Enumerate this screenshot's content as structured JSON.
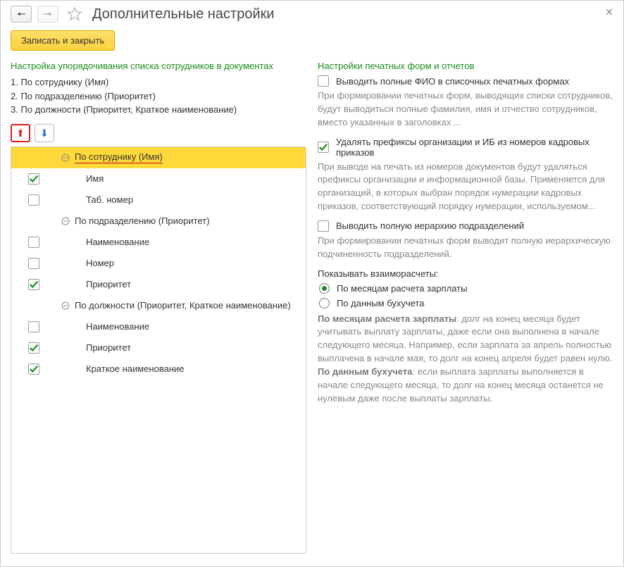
{
  "window": {
    "title": "Дополнительные настройки"
  },
  "toolbar": {
    "save_close": "Записать и закрыть"
  },
  "left": {
    "section_title": "Настройка упорядочивания списка сотрудников в документах",
    "ordering": [
      "1. По сотруднику (Имя)",
      "2. По подразделению (Приоритет)",
      "3. По должности (Приоритет, Краткое наименование)"
    ],
    "tree": {
      "groups": [
        {
          "label": "По сотруднику (Имя)",
          "selected": true,
          "items": [
            {
              "label": "Имя",
              "checked": true
            },
            {
              "label": "Таб. номер",
              "checked": false
            }
          ]
        },
        {
          "label": "По подразделению (Приоритет)",
          "selected": false,
          "items": [
            {
              "label": "Наименование",
              "checked": false
            },
            {
              "label": "Номер",
              "checked": false
            },
            {
              "label": "Приоритет",
              "checked": true
            }
          ]
        },
        {
          "label": "По должности (Приоритет, Краткое наименование)",
          "selected": false,
          "items": [
            {
              "label": "Наименование",
              "checked": false
            },
            {
              "label": "Приоритет",
              "checked": true
            },
            {
              "label": "Краткое наименование",
              "checked": true
            }
          ]
        }
      ]
    }
  },
  "right": {
    "section_title": "Настройки печатных форм и отчетов",
    "opt_full_fio": {
      "label": "Выводить полные ФИО в списочных печатных формах",
      "checked": false,
      "desc": "При формировании печатных форм, выводящих списки сотрудников, будут выводиться полные фамилия, имя и отчество сотрудников, вместо указанных в заголовках ..."
    },
    "opt_delete_prefix": {
      "label": "Удалять префиксы организации и ИБ из номеров кадровых приказов",
      "checked": true,
      "desc": "При выводе на печать из номеров документов будут удаляться префиксы организации и информационной базы. Применяется для организаций, в которых выбран порядок нумерации кадровых приказов, соответствующий порядку нумерации, используемом..."
    },
    "opt_hierarchy": {
      "label": "Выводить полную иерархию подразделений",
      "checked": false,
      "desc": "При формировании печатных форм выводит полную иерархическую подчиненность подразделений."
    },
    "mutual": {
      "title": "Показывать взаиморасчеты:",
      "radio1": "По месяцам расчета зарплаты",
      "radio2": "По данным бухучета",
      "selected": 0,
      "info_bold1": "По месяцам расчета зарплаты",
      "info_text1": ": долг на конец месяца будет учитывать выплату зарплаты, даже если она выполнена в начале следующего месяца. Например, если зарплата за апрель полностью выплачена в начале мая, то долг на конец апреля будет равен нулю.",
      "info_bold2": "По данным бухучета",
      "info_text2": ": если выплата зарплаты выполняется в начале следующего месяца, то долг на конец месяца останется не нулевым даже после выплаты зарплаты."
    }
  }
}
